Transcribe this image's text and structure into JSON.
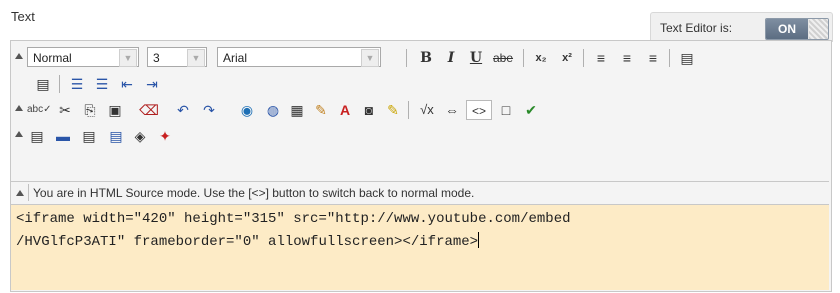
{
  "field": {
    "label": "Text"
  },
  "text_editor_toggle": {
    "label": "Text Editor is:",
    "state": "ON"
  },
  "toolbar": {
    "paragraph_format": "Normal",
    "font_size": "3",
    "font_family": "Arial",
    "bold": "B",
    "italic": "I",
    "underline": "U",
    "strikethrough": "abe",
    "subscript_sym": "x₂",
    "superscript_sym": "x²",
    "sqrt_sym": "√x",
    "source_sym": "<>"
  },
  "icons": {
    "collapse": "collapse-triangle-icon",
    "spellcheck": "spellcheck-icon",
    "math": "math-equation-icon",
    "html_source": "html-source-icon"
  },
  "mode_notice": "You are in HTML Source mode. Use the [<>] button to switch back to normal mode.",
  "source": {
    "line1": "<iframe width=\"420\" height=\"315\" src=\"http://www.youtube.com/embed",
    "line2": "/HVGlfcP3ATI\" frameborder=\"0\" allowfullscreen></iframe>"
  },
  "colors": {
    "source_bg": "#fdebc6",
    "toggle_on": "#6b7b8f",
    "toolbar_bg": "#f4f4f4"
  }
}
